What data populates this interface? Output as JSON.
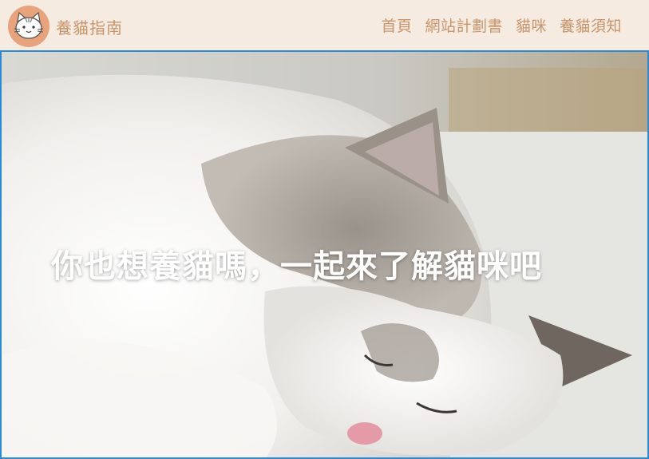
{
  "header": {
    "brand_name": "養貓指南",
    "logo_icon": "cat-face-icon",
    "nav": [
      {
        "label": "首頁"
      },
      {
        "label": "網站計劃書"
      },
      {
        "label": "貓咪"
      },
      {
        "label": "養貓須知"
      }
    ]
  },
  "hero": {
    "title": "你也想養貓嗎，一起來了解貓咪吧",
    "image_icon": "sleeping-cat-photo"
  },
  "colors": {
    "header_bg": "#f6ebe1",
    "accent": "#c8956a",
    "hero_border": "#2b8ad8",
    "title_text": "#ffffff"
  }
}
